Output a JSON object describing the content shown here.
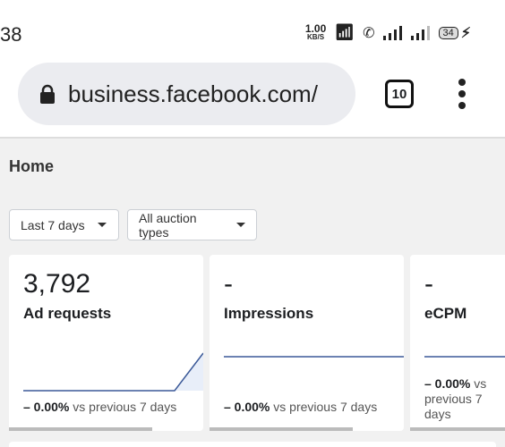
{
  "status_bar": {
    "time": "38",
    "net_speed": "1.00",
    "net_unit": "KB/S",
    "battery": "34"
  },
  "browser": {
    "url": "business.facebook.com/",
    "tab_count": "10"
  },
  "page": {
    "title": "Home"
  },
  "filters": {
    "date_range": "Last 7 days",
    "auction_type": "All auction types"
  },
  "cards": [
    {
      "value": "3,792",
      "label": "Ad requests",
      "change": "– 0.00%",
      "compare": "vs previous 7 days"
    },
    {
      "value": "-",
      "label": "Impressions",
      "change": "– 0.00%",
      "compare": "vs previous 7 days"
    },
    {
      "value": "-",
      "label": "eCPM",
      "change": "– 0.00%",
      "compare": "vs previous 7 days"
    }
  ],
  "colors": {
    "sparkline": "#3b5998",
    "sparkline_fill": "#e8eef9"
  }
}
